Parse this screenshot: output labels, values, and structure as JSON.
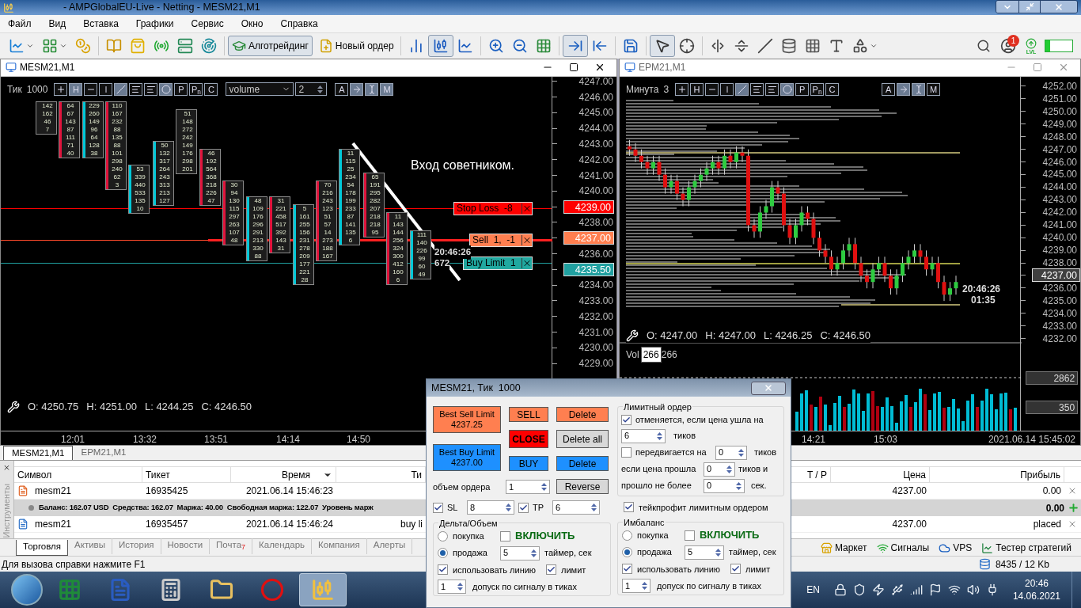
{
  "window": {
    "title": "- AMPGlobalEU-Live - Netting - MESM21,M1"
  },
  "menu": [
    "Файл",
    "Вид",
    "Вставка",
    "Графики",
    "Сервис",
    "Окно",
    "Справка"
  ],
  "toolbar": {
    "algo_button": {
      "label": "Алготрейдинг",
      "selected": true
    },
    "new_order_button": "Новый ордер",
    "notification_count": "1",
    "level_label": "LVL"
  },
  "chart_left": {
    "title": "MESM21,M1",
    "period": "Тик",
    "period_value": "1000",
    "tool_buttons": [
      {
        "kind": "plus",
        "selected": false
      },
      {
        "kind": "text",
        "label": "H",
        "selected": true
      },
      {
        "kind": "hline",
        "selected": false
      },
      {
        "kind": "vline",
        "selected": false
      },
      {
        "kind": "trend",
        "selected": true
      },
      {
        "kind": "lines",
        "selected": false
      },
      {
        "kind": "lines2",
        "selected": false
      },
      {
        "kind": "dot",
        "selected": true
      },
      {
        "kind": "text",
        "label": "P",
        "selected": false
      },
      {
        "kind": "text",
        "label": "P$_{n}$",
        "selected": false
      },
      {
        "kind": "text",
        "label": "C",
        "selected": false
      }
    ],
    "indicator_select": "volume",
    "indicator_value": "2",
    "extra_buttons": [
      {
        "kind": "text",
        "label": "A",
        "selected": false
      },
      {
        "kind": "arrow",
        "selected": true
      },
      {
        "kind": "ibeam",
        "selected": true
      },
      {
        "kind": "text",
        "label": "M",
        "selected": true
      }
    ],
    "footprint": [
      {
        "values": [
          "142",
          "162",
          "46",
          "7"
        ]
      },
      {
        "color": "#e0143c",
        "values": [
          "64",
          "67",
          "143",
          "87",
          "111",
          "71",
          "40"
        ]
      },
      {
        "color": "#00c8d8",
        "values": [
          "229",
          "260",
          "149",
          "96",
          "64",
          "128",
          "38"
        ]
      },
      {
        "color": "#e0143c",
        "values": [
          "110",
          "167",
          "232",
          "88",
          "135",
          "88",
          "101",
          "298",
          "240",
          "62",
          "3"
        ]
      },
      {
        "color": "#00c8d8",
        "values": [
          "53",
          "339",
          "440",
          "533",
          "135",
          "10"
        ]
      },
      {
        "color": "#00c8d8",
        "values": [
          "50",
          "132",
          "317",
          "264",
          "243",
          "313",
          "213",
          "127"
        ]
      },
      {
        "values": [
          "51",
          "148",
          "272",
          "242",
          "149",
          "176",
          "298",
          "201"
        ]
      },
      {
        "color": "#e0143c",
        "values": [
          "46",
          "192",
          "564",
          "368",
          "218",
          "226",
          "47"
        ]
      },
      {
        "color": "#e0143c",
        "values": [
          "30",
          "94",
          "130",
          "115",
          "297",
          "263",
          "107",
          "48"
        ]
      },
      {
        "color": "#00c8d8",
        "values": [
          "48",
          "109",
          "176",
          "296",
          "291",
          "213",
          "330",
          "88"
        ]
      },
      {
        "color": "#e0143c",
        "values": [
          "31",
          "221",
          "458",
          "517",
          "392",
          "143",
          "31"
        ]
      },
      {
        "color": "#00c8d8",
        "values": [
          "5",
          "161",
          "255",
          "156",
          "231",
          "278",
          "209",
          "177",
          "221",
          "28"
        ]
      },
      {
        "color": "#e0143c",
        "values": [
          "70",
          "216",
          "243",
          "123",
          "51",
          "57",
          "14",
          "273",
          "188",
          "167"
        ]
      },
      {
        "color": "#00c8d8",
        "values": [
          "11",
          "115",
          "25",
          "234",
          "54",
          "178",
          "199",
          "233",
          "87",
          "141",
          "135",
          "6"
        ]
      },
      {
        "color": "#e0143c",
        "values": [
          "65",
          "191",
          "295",
          "282",
          "207",
          "218",
          "218",
          "95"
        ]
      },
      {
        "color": "#e0143c",
        "values": [
          "11",
          "143",
          "144",
          "256",
          "324",
          "300",
          "412",
          "160",
          "6"
        ]
      },
      {
        "color": "#00c8d8",
        "values": [
          "111",
          "140",
          "226",
          "99",
          "60",
          "49"
        ]
      }
    ],
    "annotation": "Вход советником.",
    "orders": [
      {
        "kind": "stop",
        "label": "Stop Loss  -8"
      },
      {
        "kind": "sell",
        "label": "Sell  1,  -1"
      },
      {
        "kind": "buy",
        "label": "Buy Limit  1"
      }
    ],
    "timer": [
      "20:46:26",
      "672"
    ],
    "price_axis": [
      {
        "kind": "tick",
        "label": "4247.00"
      },
      {
        "kind": "tick",
        "label": "4246.00"
      },
      {
        "kind": "tick",
        "label": "4245.00"
      },
      {
        "kind": "tick",
        "label": "4244.00"
      },
      {
        "kind": "tick",
        "label": "4243.00"
      },
      {
        "kind": "tick",
        "label": "4242.00"
      },
      {
        "kind": "tick",
        "label": "4241.00"
      },
      {
        "kind": "tick",
        "label": "4240.00"
      },
      {
        "kind": "tag",
        "label": "4239.00",
        "color": "#ff0000"
      },
      {
        "kind": "tick",
        "label": "4238.00"
      },
      {
        "kind": "tag",
        "label": "4237.00",
        "color": "#ff7f50"
      },
      {
        "kind": "tick",
        "label": "4236.00"
      },
      {
        "kind": "tag",
        "label": "4235.50",
        "color": "#20a0a0"
      },
      {
        "kind": "tick",
        "label": "4234.00"
      },
      {
        "kind": "tick",
        "label": "4233.00"
      },
      {
        "kind": "tick",
        "label": "4232.00"
      },
      {
        "kind": "tick",
        "label": "4231.00"
      },
      {
        "kind": "tick",
        "label": "4230.00"
      },
      {
        "kind": "tick",
        "label": "4229.00"
      }
    ],
    "ohlc": [
      "O: 4250.75",
      "H: 4251.00",
      "L: 4244.25",
      "C: 4246.50"
    ],
    "time_axis": [
      "12:01",
      "13:32",
      "13:51",
      "14:14",
      "14:50"
    ]
  },
  "chart_right": {
    "title": "EPM21,M1",
    "period": "Минута",
    "period_value": "3",
    "tool_buttons": [
      {
        "kind": "plus",
        "selected": false
      },
      {
        "kind": "text",
        "label": "H",
        "selected": false
      },
      {
        "kind": "hline",
        "selected": false
      },
      {
        "kind": "vline",
        "selected": false
      },
      {
        "kind": "trend",
        "selected": true
      },
      {
        "kind": "lines",
        "selected": false
      },
      {
        "kind": "lines2",
        "selected": false
      },
      {
        "kind": "dot",
        "selected": true
      },
      {
        "kind": "text",
        "label": "P",
        "selected": false
      },
      {
        "kind": "text",
        "label": "P$_{n}$",
        "selected": false
      },
      {
        "kind": "text",
        "label": "C",
        "selected": false
      }
    ],
    "extra_buttons": [
      {
        "kind": "text",
        "label": "A",
        "selected": false
      },
      {
        "kind": "arrow",
        "selected": true
      },
      {
        "kind": "ibeam",
        "selected": true
      },
      {
        "kind": "text",
        "label": "M",
        "selected": false
      }
    ],
    "price_axis": [
      {
        "kind": "tick",
        "label": "4252.00"
      },
      {
        "kind": "tick",
        "label": "4251.00"
      },
      {
        "kind": "tick",
        "label": "4250.00"
      },
      {
        "kind": "tick",
        "label": "4249.00"
      },
      {
        "kind": "tick",
        "label": "4248.00"
      },
      {
        "kind": "tick",
        "label": "4247.00"
      },
      {
        "kind": "tick",
        "label": "4246.00"
      },
      {
        "kind": "tick",
        "label": "4245.00"
      },
      {
        "kind": "tick",
        "label": "4244.00"
      },
      {
        "kind": "tick",
        "label": "4243.00"
      },
      {
        "kind": "tick",
        "label": "4242.00"
      },
      {
        "kind": "tick",
        "label": "4241.00"
      },
      {
        "kind": "tick",
        "label": "4240.00"
      },
      {
        "kind": "tick",
        "label": "4239.00"
      },
      {
        "kind": "tick",
        "label": "4238.00"
      },
      {
        "kind": "tag",
        "label": "4237.00",
        "color": "#404040"
      },
      {
        "kind": "tick",
        "label": "4236.00"
      },
      {
        "kind": "tick",
        "label": "4235.00"
      },
      {
        "kind": "tick",
        "label": "4234.00"
      },
      {
        "kind": "tick",
        "label": "4233.00"
      },
      {
        "kind": "tick",
        "label": "4232.00"
      }
    ],
    "timer": [
      "20:46:26",
      "01:35"
    ],
    "ohlc": [
      "O: 4247.00",
      "H: 4247.00",
      "L: 4246.25",
      "C: 4246.50"
    ],
    "volume_label": "Vol",
    "volume_tooltip": "266",
    "volume_value": "266",
    "volume_axis": [
      "2862",
      "350"
    ],
    "time_axis": [
      "14:21",
      "15:03"
    ],
    "time_stamp": "2021.06.14 15:45:02"
  },
  "chart_tabs": [
    {
      "label": "MESM21,M1",
      "selected": true
    },
    {
      "label": "EPM21,M1",
      "selected": false
    }
  ],
  "toolbox": {
    "side_label": "Инструменты",
    "columns": [
      {
        "label": "Символ",
        "sorted": false
      },
      {
        "label": "Тикет",
        "sorted": false
      },
      {
        "label": "Время",
        "sorted": true
      },
      {
        "label": "Ти",
        "sorted": false
      },
      {
        "label": "T / P",
        "sorted": false
      },
      {
        "label": "Цена",
        "sorted": false
      },
      {
        "label": "Прибыль",
        "sorted": false
      }
    ],
    "rows": [
      {
        "kind": "sell",
        "symbol": "mesm21",
        "ticket": "16935425",
        "time": "2021.06.14 15:46:23",
        "price": "4237.00",
        "profit": "0.00"
      },
      {
        "kind": "summary",
        "text": "Баланс: 162.07 USD  Средства: 162.07  Маржа: 40.00  Свободная маржа: 122.07  Уровень марж",
        "profit": "0.00"
      },
      {
        "kind": "buy",
        "symbol": "mesm21",
        "ticket": "16935457",
        "time": "2021.06.14 15:46:24",
        "type": "buy li",
        "price": "4237.00",
        "profit": "placed"
      }
    ],
    "tabs": [
      {
        "label": "Торговля",
        "selected": true
      },
      {
        "label": "Активы",
        "selected": false
      },
      {
        "label": "История",
        "selected": false
      },
      {
        "label": "Новости",
        "selected": false
      },
      {
        "label": "Почта",
        "badge": "7",
        "selected": false
      },
      {
        "label": "Календарь",
        "selected": false
      },
      {
        "label": "Компания",
        "selected": false
      },
      {
        "label": "Алерты",
        "selected": false
      }
    ],
    "links": [
      "Маркет",
      "Сигналы",
      "VPS",
      "Тестер стратегий"
    ]
  },
  "status_bar": {
    "help": "Для вызова справки нажмите F1",
    "traffic": "8435 / 12 Kb"
  },
  "order_panel": {
    "title": "MESM21, Тик  1000",
    "best_limits": [
      {
        "kind": "sell",
        "label": "Best Sell Limit",
        "price": "4237.25"
      },
      {
        "kind": "buy",
        "label": "Best Buy Limit",
        "price": "4237.00"
      }
    ],
    "trade_buttons": [
      {
        "kind": "sell",
        "label": "SELL"
      },
      {
        "kind": "close",
        "label": "CLOSE"
      },
      {
        "kind": "buy",
        "label": "BUY"
      }
    ],
    "delete_buttons": [
      {
        "kind": "sell",
        "label": "Delete"
      },
      {
        "kind": "neutral",
        "label": "Delete all"
      },
      {
        "kind": "buy",
        "label": "Delete"
      },
      {
        "kind": "neutral",
        "label": "Reverse"
      }
    ],
    "volume": {
      "label": "объем ордера",
      "value": "1"
    },
    "sl": {
      "label": "SL",
      "checked": true,
      "value": "8"
    },
    "tp": {
      "label": "TP",
      "checked": true,
      "value": "6"
    },
    "limit_order": {
      "title": "Лимитный ордер",
      "cancel": {
        "label": "отменяется, если цена ушла на",
        "checked": true,
        "value": "6",
        "unit": "тиков"
      },
      "move": {
        "label": "передвигается на",
        "checked": false,
        "value": "0",
        "unit": "тиков"
      },
      "if_passed": {
        "label": "если цена прошла",
        "value": "0",
        "unit": "тиков и"
      },
      "within": {
        "label": "прошло не более",
        "value": "0",
        "unit": "сек."
      }
    },
    "take_profit_limit": {
      "label": "тейкпрофит лимитным ордером",
      "checked": true
    },
    "strategies": [
      {
        "title": "Дельта/Объем",
        "sides": [
          {
            "label": "покупка",
            "selected": false
          },
          {
            "label": "продажа",
            "selected": true
          }
        ],
        "enable": {
          "label": "ВКЛЮЧИТЬ",
          "checked": false
        },
        "timer": {
          "value": "5",
          "unit": "таймер, сек"
        },
        "use_line": {
          "label": "использовать линию",
          "checked": true
        },
        "limit": {
          "label": "лимит",
          "checked": true
        },
        "tolerance": {
          "value": "1",
          "unit": "допуск по сигналу в тиках"
        }
      },
      {
        "title": "Имбаланс",
        "sides": [
          {
            "label": "покупка",
            "selected": false
          },
          {
            "label": "продажа",
            "selected": true
          }
        ],
        "enable": {
          "label": "ВКЛЮЧИТЬ",
          "checked": false
        },
        "timer": {
          "value": "5",
          "unit": "таймер, сек"
        },
        "use_line": {
          "label": "использовать линию",
          "checked": true
        },
        "limit": {
          "label": "лимит",
          "checked": true
        },
        "tolerance": {
          "value": "1",
          "unit": "допуск по сигналу в тиках"
        }
      }
    ]
  },
  "taskbar": {
    "language": "EN",
    "time": "20:46",
    "date": "14.06.2021"
  }
}
